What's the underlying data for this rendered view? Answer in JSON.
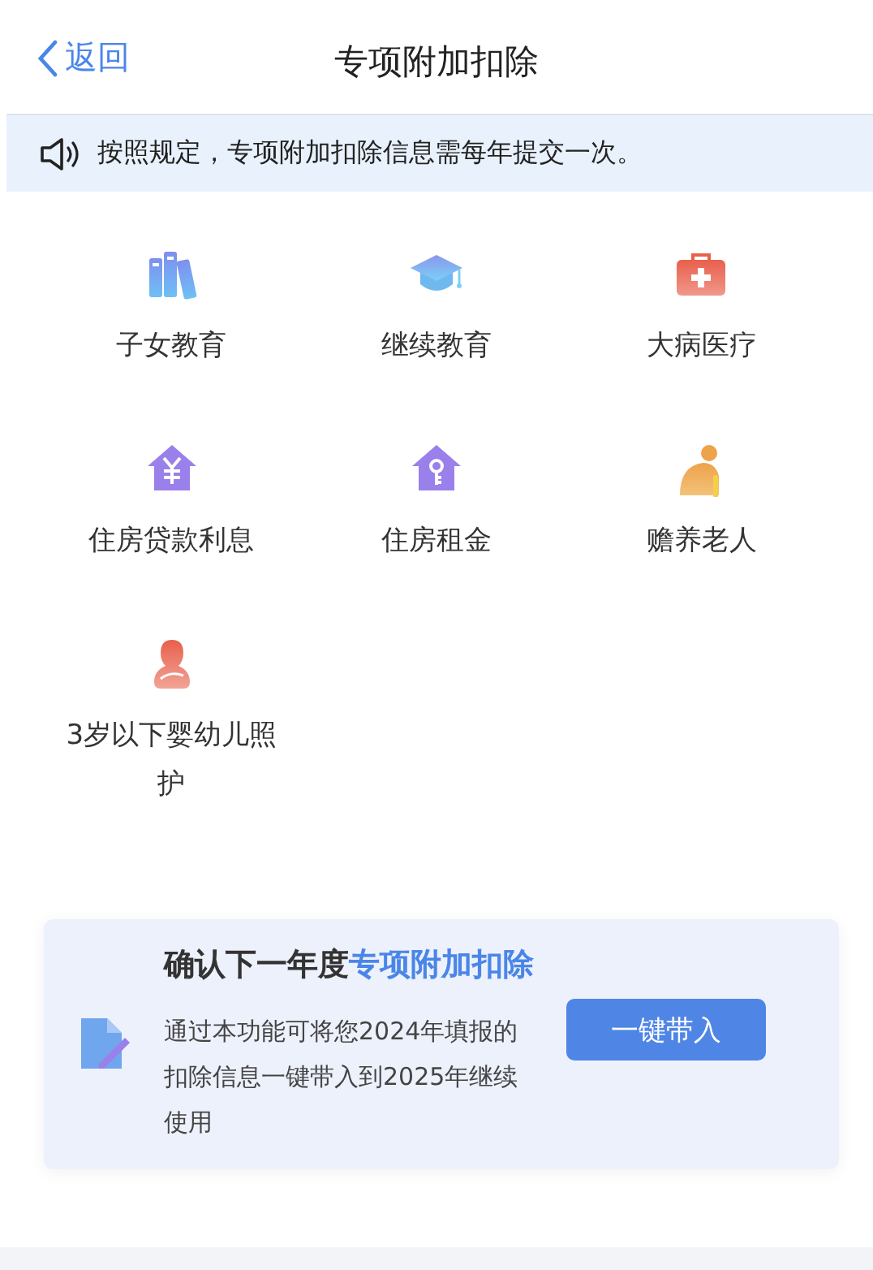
{
  "nav": {
    "back": "返回",
    "title": "专项附加扣除"
  },
  "notice": {
    "text": "按照规定，专项附加扣除信息需每年提交一次。"
  },
  "items": [
    {
      "kind": "books",
      "label": "子女教育"
    },
    {
      "kind": "cap",
      "label": "继续教育"
    },
    {
      "kind": "medkit",
      "label": "大病医疗"
    },
    {
      "kind": "house-yuan",
      "label": "住房贷款利息"
    },
    {
      "kind": "house-key",
      "label": "住房租金"
    },
    {
      "kind": "elder",
      "label": "赡养老人"
    },
    {
      "kind": "mother",
      "label": "3岁以下婴幼儿照护"
    }
  ],
  "card": {
    "title": "确认下一年度",
    "title_highlight": "专项附加扣除",
    "body": "通过本功能可将您2024年填报的扣除信息一键带入到2025年继续使用",
    "button": "一键带入"
  }
}
